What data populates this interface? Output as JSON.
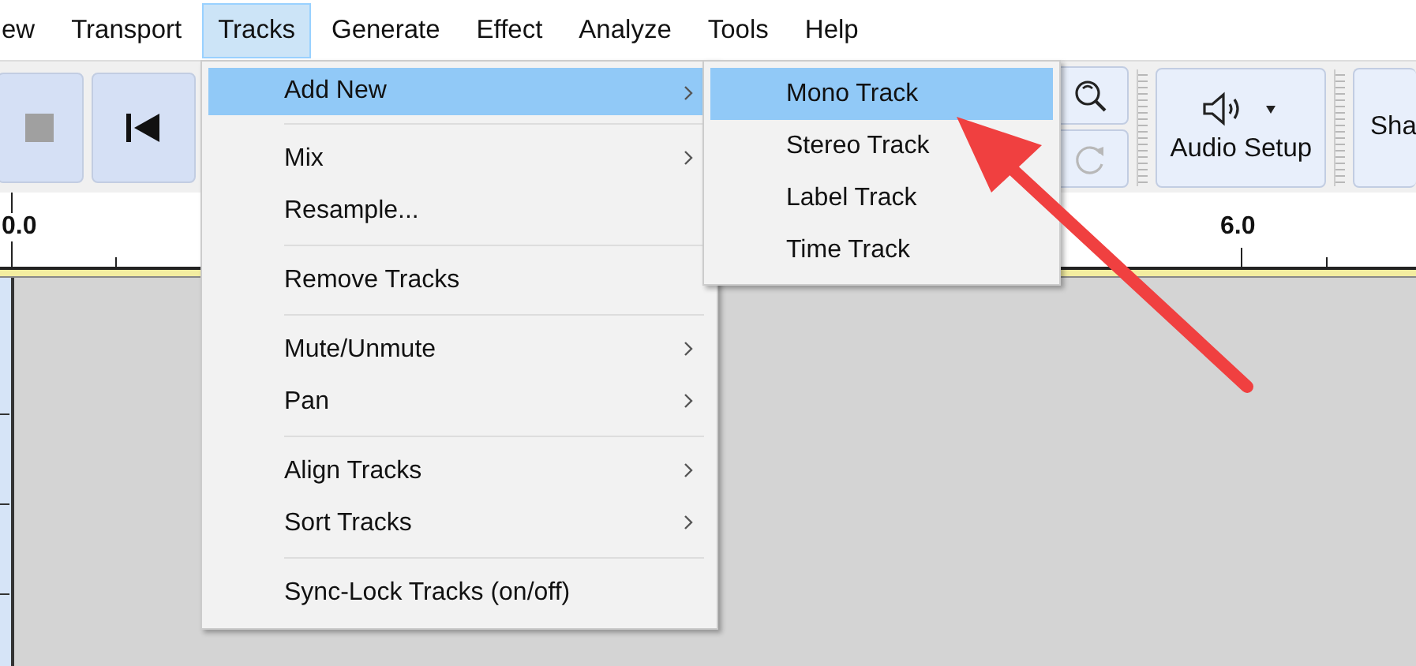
{
  "menubar": [
    {
      "label": "ew",
      "selected": false
    },
    {
      "label": "Transport",
      "selected": false
    },
    {
      "label": "Tracks",
      "selected": true
    },
    {
      "label": "Generate",
      "selected": false
    },
    {
      "label": "Effect",
      "selected": false
    },
    {
      "label": "Analyze",
      "selected": false
    },
    {
      "label": "Tools",
      "selected": false
    },
    {
      "label": "Help",
      "selected": false
    }
  ],
  "toolbar": {
    "audio_setup": "Audio Setup",
    "share": "Sha",
    "redo_disabled": true
  },
  "ruler": {
    "labels": [
      "0.0",
      "6.0"
    ]
  },
  "tracks_menu": [
    [
      {
        "label": "Add New",
        "submenu": true,
        "selected": true
      }
    ],
    [
      {
        "label": "Mix",
        "submenu": true,
        "selected": false
      },
      {
        "label": "Resample...",
        "submenu": false,
        "selected": false
      }
    ],
    [
      {
        "label": "Remove Tracks",
        "submenu": false,
        "selected": false
      }
    ],
    [
      {
        "label": "Mute/Unmute",
        "submenu": true,
        "selected": false
      },
      {
        "label": "Pan",
        "submenu": true,
        "selected": false
      }
    ],
    [
      {
        "label": "Align Tracks",
        "submenu": true,
        "selected": false
      },
      {
        "label": "Sort Tracks",
        "submenu": true,
        "selected": false
      }
    ],
    [
      {
        "label": "Sync-Lock Tracks (on/off)",
        "submenu": false,
        "selected": false
      }
    ]
  ],
  "add_new_menu": [
    {
      "label": "Mono Track",
      "selected": true
    },
    {
      "label": "Stereo Track",
      "selected": false
    },
    {
      "label": "Label Track",
      "selected": false
    },
    {
      "label": "Time Track",
      "selected": false
    }
  ]
}
